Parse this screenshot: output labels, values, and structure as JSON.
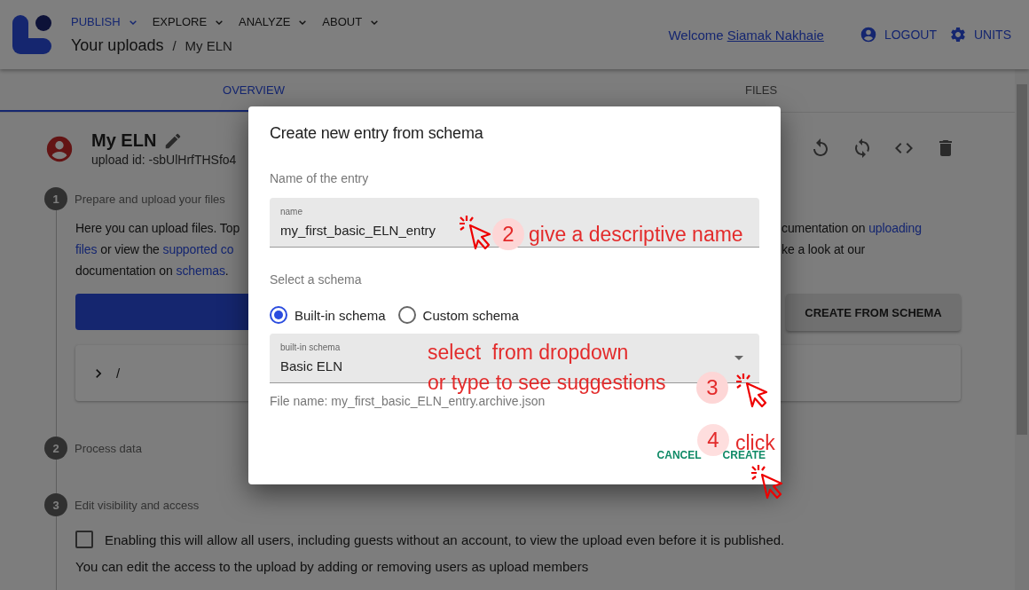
{
  "header": {
    "nav": [
      {
        "label": "PUBLISH",
        "selected": true
      },
      {
        "label": "EXPLORE",
        "selected": false
      },
      {
        "label": "ANALYZE",
        "selected": false
      },
      {
        "label": "ABOUT",
        "selected": false
      }
    ],
    "breadcrumb": {
      "parent": "Your uploads",
      "separator": "/",
      "current": "My ELN"
    },
    "welcome": "Welcome",
    "user": "Siamak Nakhaie",
    "actions": [
      {
        "label": "LOGOUT",
        "kind": "logout"
      },
      {
        "label": "UNITS",
        "kind": "units"
      }
    ]
  },
  "tabs": [
    {
      "label": "OVERVIEW",
      "selected": true
    },
    {
      "label": "FILES",
      "selected": false
    }
  ],
  "upload": {
    "title": "My ELN",
    "upload_id": "upload id: -sbUlHrfTHSfo4"
  },
  "steps": [
    {
      "number": "1",
      "label": "Prepare and upload your files",
      "kind": "files"
    },
    {
      "number": "2",
      "label": "Process data",
      "kind": "process"
    },
    {
      "number": "3",
      "label": "Edit visibility and access",
      "kind": "visibility"
    }
  ],
  "files_step": {
    "intro_left": [
      [
        {
          "text": "Here you can upload files. Top",
          "link": false
        }
      ],
      [
        {
          "text": "files",
          "link": true
        },
        {
          "text": " or view the ",
          "link": false
        },
        {
          "text": "supported co",
          "link": true
        }
      ],
      [
        {
          "text": "documentation on ",
          "link": false
        },
        {
          "text": "schemas",
          "link": true
        },
        {
          "text": ".",
          "link": false
        }
      ]
    ],
    "intro_right": [
      [
        {
          "text": "cumentation on ",
          "link": false
        },
        {
          "text": "uploading",
          "link": true
        }
      ],
      [
        {
          "text": "ke a look at our",
          "link": false
        }
      ]
    ],
    "create_button": "CREATE FROM SCHEMA",
    "tree_path": "/"
  },
  "visibility_step": {
    "public": {
      "label": "Enabling this will allow all users, including guests without an account, to view the upload even before it is published.",
      "checked": false
    },
    "note": "You can edit the access to the upload by adding or removing users as upload members"
  },
  "dialog": {
    "title": "Create new entry from schema",
    "name_section": "Name of the entry",
    "name_field": {
      "label": "name",
      "value": "my_first_basic_ELN_entry"
    },
    "schema_section": "Select a schema",
    "schema_options": [
      {
        "label": "Built-in schema",
        "selected": true
      },
      {
        "label": "Custom schema",
        "selected": false
      }
    ],
    "schema_field": {
      "label": "built-in schema",
      "value": "Basic ELN"
    },
    "file_name": "File name: my_first_basic_ELN_entry.archive.json",
    "buttons": [
      {
        "label": "CANCEL"
      },
      {
        "label": "CREATE"
      }
    ]
  },
  "annotations": [
    {
      "number": "2",
      "lines": [
        "give a descriptive name"
      ]
    },
    {
      "number": "3",
      "lines": [
        "select  from dropdown",
        "or type to see suggestions"
      ]
    },
    {
      "number": "4",
      "lines": [
        "click"
      ]
    }
  ]
}
